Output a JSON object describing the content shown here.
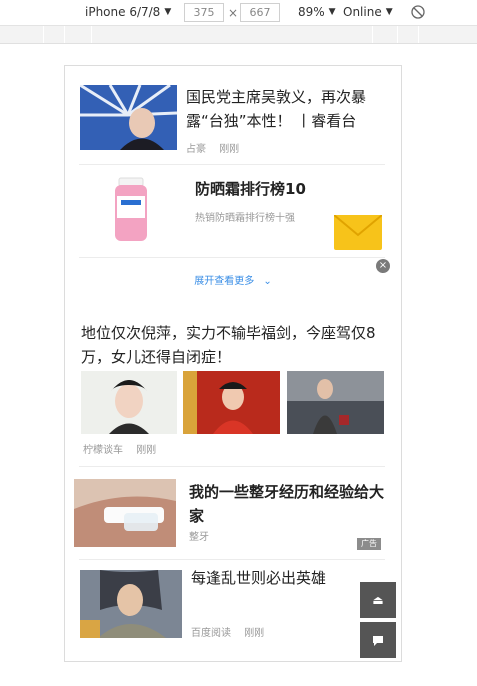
{
  "toolbar": {
    "device": "iPhone 6/7/8",
    "width": "375",
    "height": "667",
    "times": "×",
    "zoom": "89%",
    "network": "Online"
  },
  "feed": {
    "item1": {
      "title": "国民党主席吴敦义，再次暴露“台独”本性！ 丨睿看台",
      "source": "占豪",
      "time": "刚刚"
    },
    "ad1": {
      "title": "防晒霜排行榜10",
      "subtitle": "热销防晒霜排行榜十强",
      "expand_label": "展开查看更多",
      "close": "×"
    },
    "item2": {
      "title": "地位仅次倪萍，实力不输毕福剑，今座驾仅8万，女儿还得自闭症！",
      "source": "柠檬谈车",
      "time": "刚刚"
    },
    "ad2": {
      "title": "我的一些整牙经历和经验给大家",
      "source": "整牙",
      "badge": "广告"
    },
    "item3": {
      "title": "每逢乱世则必出英雄",
      "source": "百度阅读",
      "time": "刚刚"
    }
  },
  "floating": {
    "top_icon": "eject-icon",
    "comment_icon": "comment-icon"
  },
  "colors": {
    "link_blue": "#3a8ee6",
    "mail_yellow": "#f7c31a",
    "float_gray": "#555555"
  }
}
